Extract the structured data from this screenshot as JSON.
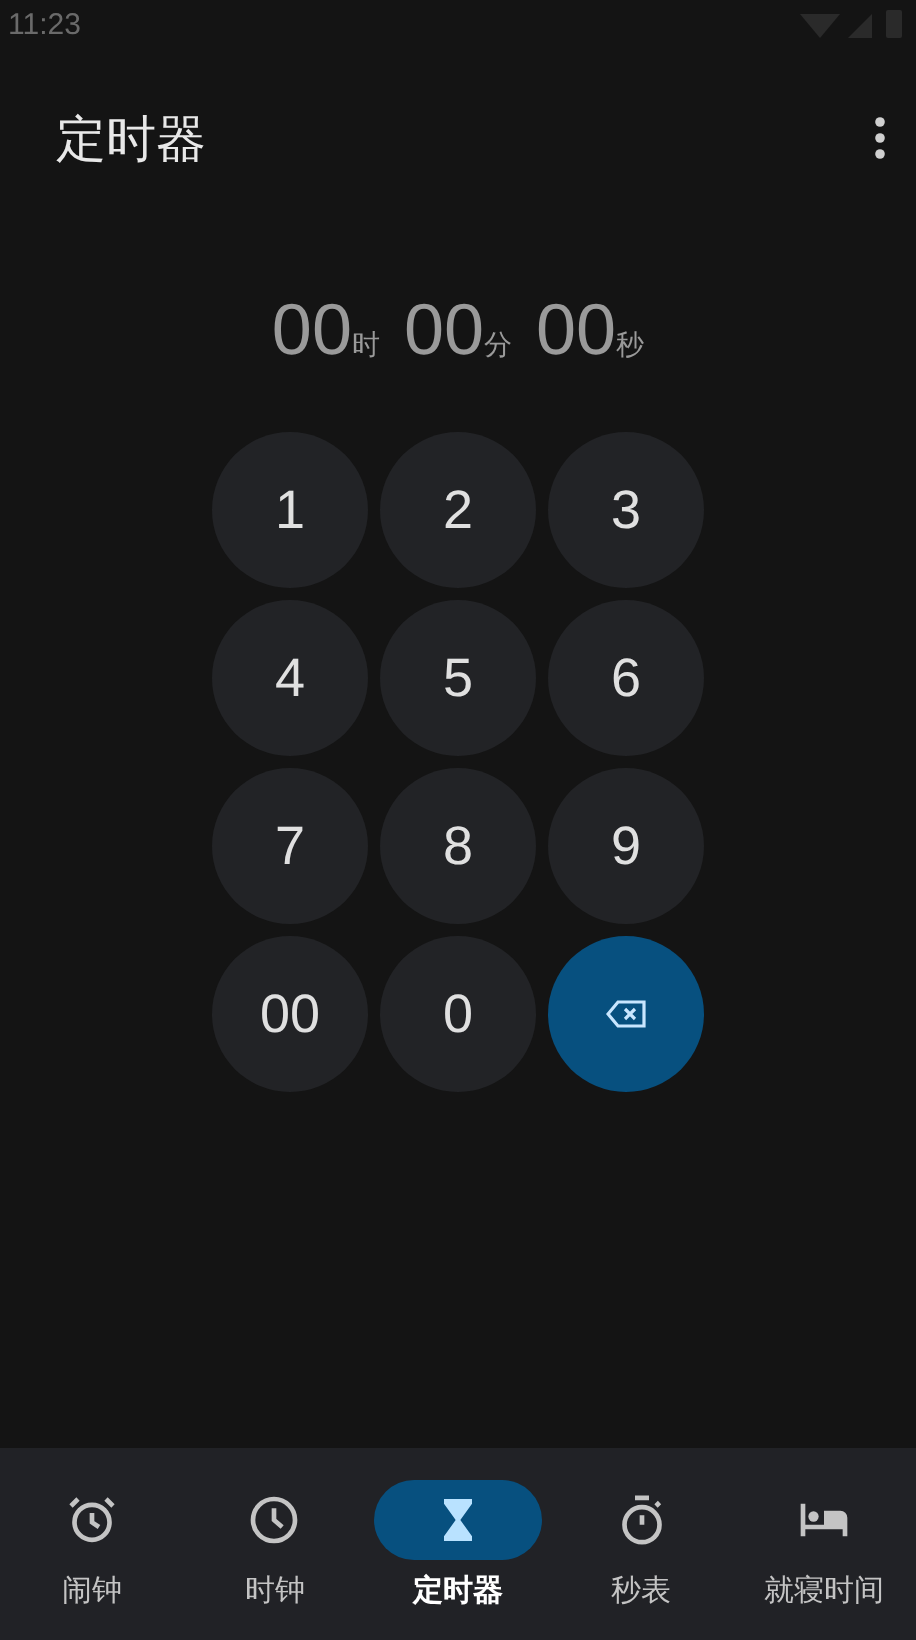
{
  "status_bar": {
    "time": "11:23"
  },
  "header": {
    "title": "定时器"
  },
  "display": [
    {
      "value": "00",
      "unit": "时"
    },
    {
      "value": "00",
      "unit": "分"
    },
    {
      "value": "00",
      "unit": "秒"
    }
  ],
  "keypad": [
    {
      "kind": "digit",
      "label": "1"
    },
    {
      "kind": "digit",
      "label": "2"
    },
    {
      "kind": "digit",
      "label": "3"
    },
    {
      "kind": "digit",
      "label": "4"
    },
    {
      "kind": "digit",
      "label": "5"
    },
    {
      "kind": "digit",
      "label": "6"
    },
    {
      "kind": "digit",
      "label": "7"
    },
    {
      "kind": "digit",
      "label": "8"
    },
    {
      "kind": "digit",
      "label": "9"
    },
    {
      "kind": "digit",
      "label": "00"
    },
    {
      "kind": "digit",
      "label": "0"
    },
    {
      "kind": "backspace"
    }
  ],
  "nav": [
    {
      "kind": "alarm",
      "label": "闹钟",
      "selected": false
    },
    {
      "kind": "clock",
      "label": "时钟",
      "selected": false
    },
    {
      "kind": "timer",
      "label": "定时器",
      "selected": true
    },
    {
      "kind": "stopwatch",
      "label": "秒表",
      "selected": false
    },
    {
      "kind": "bedtime",
      "label": "就寝时间",
      "selected": false
    }
  ]
}
